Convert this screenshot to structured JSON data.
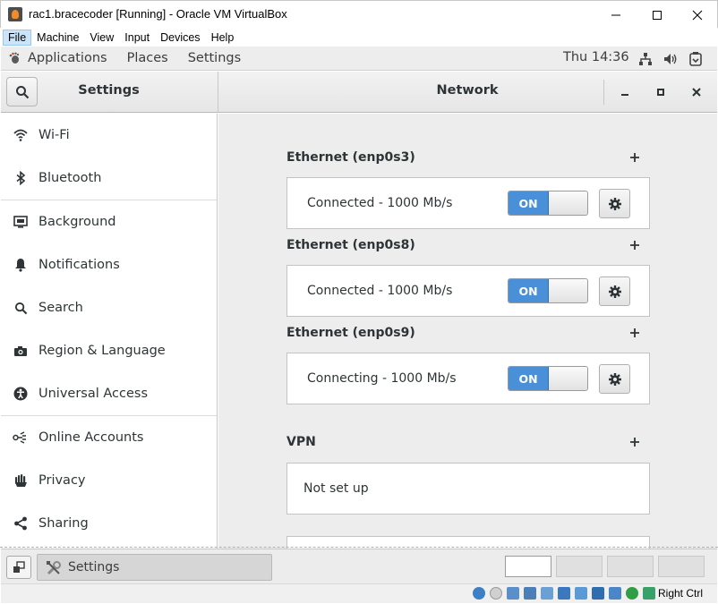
{
  "window": {
    "title": "rac1.bracecoder [Running] - Oracle VM VirtualBox"
  },
  "vbox_menu": {
    "items": [
      "File",
      "Machine",
      "View",
      "Input",
      "Devices",
      "Help"
    ]
  },
  "gnome_topbar": {
    "applications": "Applications",
    "places": "Places",
    "settings": "Settings",
    "clock": "Thu 14:36",
    "tray_icons": [
      "network-icon",
      "volume-icon",
      "power-icon"
    ]
  },
  "headerbar": {
    "left_title": "Settings",
    "right_title": "Network"
  },
  "sidebar": {
    "items": [
      {
        "label": "Wi-Fi",
        "icon": "wifi-icon"
      },
      {
        "label": "Bluetooth",
        "icon": "bluetooth-icon"
      },
      {
        "label": "Background",
        "icon": "background-icon"
      },
      {
        "label": "Notifications",
        "icon": "bell-icon"
      },
      {
        "label": "Search",
        "icon": "search-icon"
      },
      {
        "label": "Region & Language",
        "icon": "camera-icon"
      },
      {
        "label": "Universal Access",
        "icon": "accessibility-icon"
      },
      {
        "label": "Online Accounts",
        "icon": "online-accounts-icon"
      },
      {
        "label": "Privacy",
        "icon": "hand-icon"
      },
      {
        "label": "Sharing",
        "icon": "share-icon"
      }
    ]
  },
  "network": {
    "ethernet": [
      {
        "title": "Ethernet (enp0s3)",
        "status": "Connected - 1000 Mb/s",
        "switch": "ON"
      },
      {
        "title": "Ethernet (enp0s8)",
        "status": "Connected - 1000 Mb/s",
        "switch": "ON"
      },
      {
        "title": "Ethernet (enp0s9)",
        "status": "Connecting - 1000 Mb/s",
        "switch": "ON"
      }
    ],
    "vpn": {
      "title": "VPN",
      "status": "Not set up"
    }
  },
  "taskbar": {
    "task_label": "Settings",
    "workspaces": 4,
    "active_workspace": 1
  },
  "vbox_status": {
    "host_key": "Right Ctrl"
  },
  "colors": {
    "switch_on": "#4a90d9",
    "main_bg": "#ededed",
    "sidebar_bg": "#ffffff"
  }
}
